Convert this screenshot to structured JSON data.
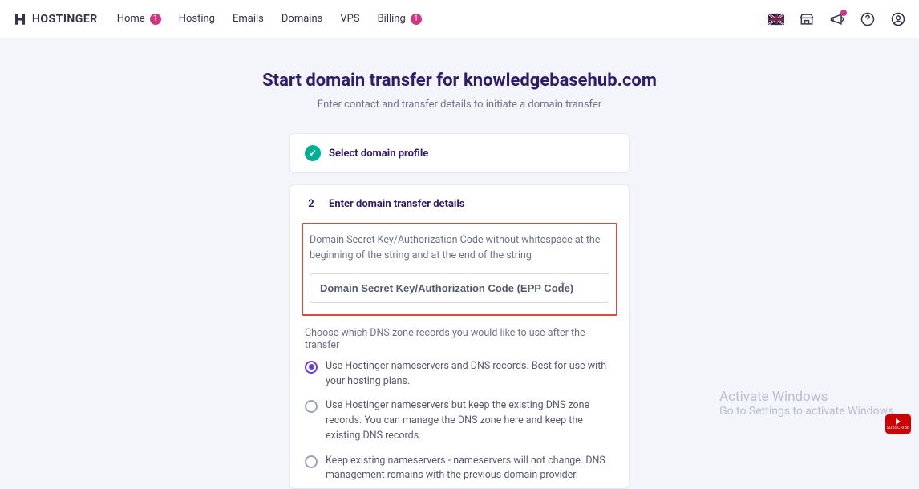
{
  "brand": "HOSTINGER",
  "nav": {
    "items": [
      {
        "label": "Home",
        "badge": "1"
      },
      {
        "label": "Hosting",
        "badge": null
      },
      {
        "label": "Emails",
        "badge": null
      },
      {
        "label": "Domains",
        "badge": null
      },
      {
        "label": "VPS",
        "badge": null
      },
      {
        "label": "Billing",
        "badge": "1"
      }
    ]
  },
  "topright": {
    "locale_flag": "UK",
    "storefront_icon": "storefront-icon",
    "announce_icon": "megaphone-icon",
    "help_icon": "help-icon",
    "account_icon": "account-icon"
  },
  "heading": "Start domain transfer for knowledgebasehub.com",
  "subheading": "Enter contact and transfer details to initiate a domain transfer",
  "step1": {
    "label": "Select domain profile",
    "completed": true
  },
  "step2": {
    "number": "2",
    "title": "Enter domain transfer details",
    "epp_help": "Domain Secret Key/Authorization Code without whitespace at the beginning of the string and at the end of the string",
    "epp_placeholder": "Domain Secret Key/Authorization Code (EPP Code)",
    "epp_value": "",
    "dns_title": "Choose which DNS zone records you would like to use after the transfer",
    "options": [
      {
        "label": "Use Hostinger nameservers and DNS records. Best for use with your hosting plans.",
        "selected": true
      },
      {
        "label": "Use Hostinger nameservers but keep the existing DNS zone records. You can manage the DNS zone here and keep the existing DNS records.",
        "selected": false
      },
      {
        "label": "Keep existing nameservers - nameservers will not change. DNS management remains with the previous domain provider.",
        "selected": false
      }
    ]
  },
  "watermark": {
    "line1": "Activate Windows",
    "line2": "Go to Settings to activate Windows."
  },
  "yt": {
    "label": "SUBSCRIBE"
  }
}
